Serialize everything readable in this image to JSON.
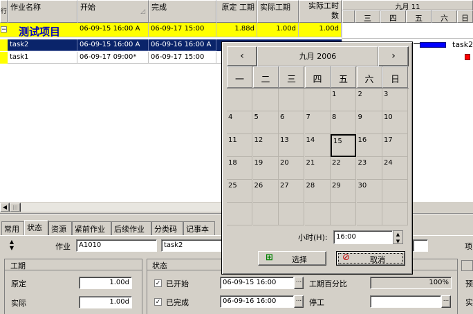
{
  "grid": {
    "headers": {
      "row_marker": "行",
      "name": "作业名称",
      "start": "开始",
      "finish": "完成",
      "orig_dur": "原定 工期",
      "actual_dur": "实际工期",
      "actual_work": "实际工时数"
    },
    "rows": [
      {
        "marker": "⊟",
        "name": "测试项目",
        "start": "06-09-15 16:00 A",
        "finish": "06-09-17 15:00",
        "orig_dur": "1.88d",
        "actual_dur": "1.00d",
        "actual_work": "1.00d"
      },
      {
        "marker": "",
        "name": "task2",
        "start": "06-09-15 16:00 A",
        "finish": "06-09-16 16:00 A",
        "orig_dur": "",
        "actual_dur": "",
        "actual_work": ""
      },
      {
        "marker": "",
        "name": "task1",
        "start": "06-09-17 09:00*",
        "finish": "06-09-17 15:00",
        "orig_dur": "",
        "actual_dur": "",
        "actual_work": ""
      }
    ]
  },
  "gantt": {
    "month": "九月 11",
    "days": [
      "三",
      "四",
      "五",
      "六",
      "日"
    ],
    "bar_label": "task2"
  },
  "tabs": [
    "常用",
    "状态",
    "资源",
    "紧前作业",
    "后续作业",
    "分类码",
    "记事本"
  ],
  "form": {
    "activity_label": "作业",
    "activity_id": "A1010",
    "activity_name": "task2",
    "right_label": "项",
    "duration_group": "工期",
    "orig_label": "原定",
    "orig_value": "1.00d",
    "actual_label": "实际",
    "actual_value": "1.00d",
    "status_group": "状态",
    "started_label": "已开始",
    "started_value": "06-09-15 16:00",
    "finished_label": "已完成",
    "finished_value": "06-09-16 16:00",
    "pct_label": "工期百分比",
    "pct_value": "100%",
    "suspend_label": "停工",
    "right2": "预",
    "right3": "实",
    "ellipsis": "..."
  },
  "calendar": {
    "title": "九月 2006",
    "prev": "‹",
    "next": "›",
    "weekdays": [
      "一",
      "二",
      "三",
      "四",
      "五",
      "六",
      "日"
    ],
    "weeks": [
      [
        "",
        "",
        "",
        "",
        "1",
        "2",
        "3"
      ],
      [
        "4",
        "5",
        "6",
        "7",
        "8",
        "9",
        "10"
      ],
      [
        "11",
        "12",
        "13",
        "14",
        "15",
        "16",
        "17"
      ],
      [
        "18",
        "19",
        "20",
        "21",
        "22",
        "23",
        "24"
      ],
      [
        "25",
        "26",
        "27",
        "28",
        "29",
        "30",
        ""
      ],
      [
        "",
        "",
        "",
        "",
        "",
        "",
        ""
      ]
    ],
    "selected_day": "15",
    "hour_label": "小时(H):",
    "hour_value": "16:00",
    "select_label": "选择",
    "cancel_label": "取消"
  },
  "colors": {
    "summary_bg": "#ffff00",
    "selected_bg": "#0a246a",
    "bar": "#0000ff",
    "milestone": "#ff0000"
  }
}
